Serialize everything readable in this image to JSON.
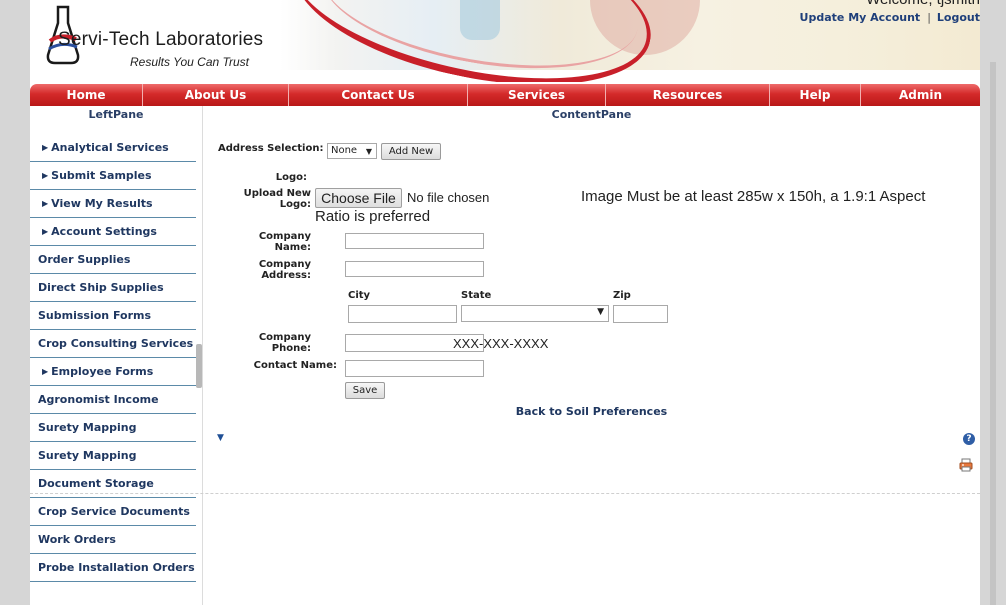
{
  "header": {
    "logo_name": "Servi-Tech Laboratories",
    "logo_tagline": "Results You Can Trust",
    "welcome": "Welcome, tjsmith",
    "update_account": "Update My Account",
    "separator": "|",
    "logout": "Logout"
  },
  "nav": {
    "items": [
      "Home",
      "About Us",
      "Contact Us",
      "Services",
      "Resources",
      "Help",
      "Admin"
    ]
  },
  "leftpane": {
    "title": "LeftPane",
    "items": [
      {
        "label": "Analytical Services",
        "arrow": true
      },
      {
        "label": "Submit Samples",
        "arrow": true
      },
      {
        "label": "View My Results",
        "arrow": true
      },
      {
        "label": "Account Settings",
        "arrow": true
      },
      {
        "label": "Order Supplies",
        "arrow": false
      },
      {
        "label": "Direct Ship Supplies",
        "arrow": false
      },
      {
        "label": "Submission Forms",
        "arrow": false
      },
      {
        "label": "Crop Consulting Services",
        "arrow": false
      },
      {
        "label": "Employee Forms",
        "arrow": true
      },
      {
        "label": "Agronomist Income",
        "arrow": false
      },
      {
        "label": "Surety Mapping",
        "arrow": false
      },
      {
        "label": "Surety Mapping",
        "arrow": false
      },
      {
        "label": "Document Storage",
        "arrow": false
      },
      {
        "label": "Crop Service Documents",
        "arrow": false
      },
      {
        "label": "Work Orders",
        "arrow": false
      },
      {
        "label": "Probe Installation Orders",
        "arrow": false
      }
    ]
  },
  "content": {
    "title": "ContentPane",
    "address_selection_label": "Address Selection:",
    "address_selection_value": "None",
    "add_new_button": "Add New",
    "logo_label": "Logo:",
    "upload_logo_label_1": "Upload New",
    "upload_logo_label_2": "Logo:",
    "choose_file_button": "Choose File",
    "no_file_text": "No file chosen",
    "image_hint_1": "Image Must be at least 285w x 150h, a 1.9:1 Aspect",
    "image_hint_2": "Ratio is preferred",
    "company_name_label_1": "Company",
    "company_name_label_2": "Name:",
    "company_name_value": "",
    "company_address_label_1": "Company",
    "company_address_label_2": "Address:",
    "company_address_value": "",
    "city_label": "City",
    "state_label": "State",
    "zip_label": "Zip",
    "city_value": "",
    "state_value": "",
    "zip_value": "",
    "company_phone_label_1": "Company",
    "company_phone_label_2": "Phone:",
    "company_phone_value": "",
    "phone_format_hint": "XXX-XXX-XXXX",
    "contact_name_label": "Contact Name:",
    "contact_name_value": "",
    "save_button": "Save",
    "back_link": "Back to Soil Preferences",
    "help_icon_glyph": "?"
  },
  "colors": {
    "nav_red": "#d42a2a",
    "link_blue": "#1f3760",
    "leftnav_border": "#5b8aa8"
  }
}
